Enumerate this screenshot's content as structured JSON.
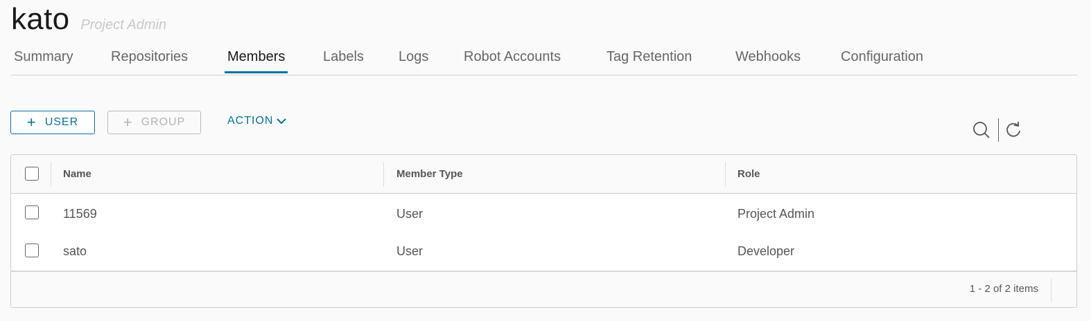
{
  "header": {
    "project_name": "kato",
    "project_role": "Project Admin"
  },
  "tabs": [
    {
      "label": "Summary"
    },
    {
      "label": "Repositories"
    },
    {
      "label": "Members",
      "active": true
    },
    {
      "label": "Labels"
    },
    {
      "label": "Logs"
    },
    {
      "label": "Robot Accounts"
    },
    {
      "label": "Tag Retention"
    },
    {
      "label": "Webhooks"
    },
    {
      "label": "Configuration"
    }
  ],
  "toolbar": {
    "add_user_label": "USER",
    "add_group_label": "GROUP",
    "action_label": "ACTION",
    "icons": [
      "search-icon",
      "refresh-icon"
    ],
    "accent_color": "#0072a3"
  },
  "table": {
    "columns": [
      "Name",
      "Member Type",
      "Role"
    ],
    "rows": [
      {
        "name": "11569",
        "member_type": "User",
        "role": "Project Admin"
      },
      {
        "name": "sato",
        "member_type": "User",
        "role": "Developer"
      }
    ],
    "pagination": "1 - 2 of 2 items"
  }
}
